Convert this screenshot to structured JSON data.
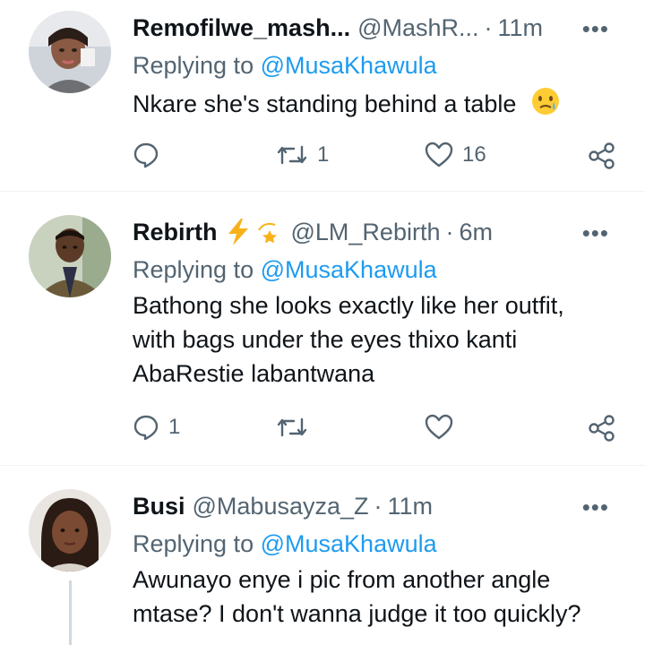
{
  "tweets": [
    {
      "name": "Remofilwe_mash...",
      "handle": "@MashR...",
      "separator": "·",
      "time": "11m",
      "reply_prefix": "Replying to",
      "reply_to": "@MusaKhawula",
      "text": "Nkare she's standing behind a table",
      "emoji": "tear-smile-emoji",
      "reply_count": "",
      "retweet_count": "1",
      "like_count": "16"
    },
    {
      "name": "Rebirth",
      "handle": "@LM_Rebirth",
      "separator": "·",
      "time": "6m",
      "reply_prefix": "Replying to",
      "reply_to": "@MusaKhawula",
      "text_lines": [
        "Bathong she looks exactly like her outfit,",
        "with bags under the eyes thixo kanti",
        "AbaRestie labantwana"
      ],
      "name_icons": [
        "lightning-icon",
        "dizzy-star-icon"
      ],
      "reply_count": "1",
      "retweet_count": "",
      "like_count": ""
    },
    {
      "name": "Busi",
      "handle": "@Mabusayza_Z",
      "separator": "·",
      "time": "11m",
      "reply_prefix": "Replying to",
      "reply_to": "@MusaKhawula",
      "text_lines": [
        "Awunayo enye i pic from another angle",
        "mtase? I don't wanna judge it too quickly?"
      ]
    }
  ],
  "more_label": "•••",
  "colors": {
    "text": "#0f1419",
    "secondary": "#536471",
    "link": "#1d9bf0",
    "divider": "#eff3f4",
    "thread": "#cfd9de"
  }
}
